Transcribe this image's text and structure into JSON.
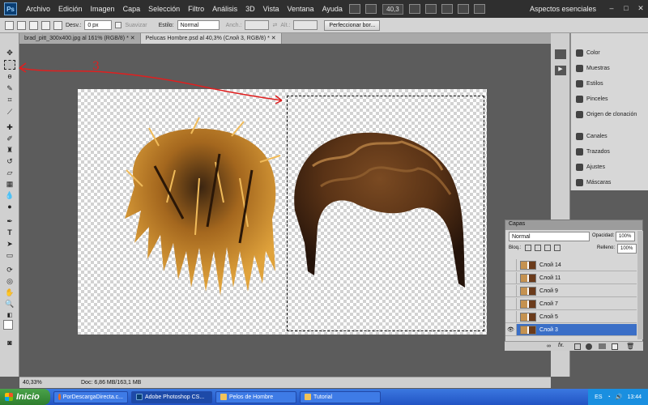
{
  "menubar": {
    "logo": "Ps",
    "items": [
      "Archivo",
      "Edición",
      "Imagen",
      "Capa",
      "Selección",
      "Filtro",
      "Análisis",
      "3D",
      "Vista",
      "Ventana",
      "Ayuda"
    ],
    "zoom": "40,3",
    "workspace": "Aspectos esenciales",
    "window_buttons": [
      "–",
      "□",
      "✕"
    ]
  },
  "options": {
    "feather_label": "Desv.:",
    "feather_value": "0 px",
    "antialias_label": "Suavizar",
    "style_label": "Estilo:",
    "style_value": "Normal",
    "width_label": "Anch.:",
    "height_label": "Alt.:",
    "refine_button": "Perfeccionar bor..."
  },
  "tabs": [
    {
      "label": "brad_pitt_300x400.jpg al 161% (RGB/8) *  ✕"
    },
    {
      "label": "Pelucas Hombre.psd al 40,3% (Слой 3, RGB/8) *  ✕"
    }
  ],
  "annotation": {
    "number": "3",
    "color": "#e01f1f"
  },
  "status": {
    "zoom": "40,33%",
    "doc": "Doc: 6,86 MB/163,1 MB"
  },
  "panels": [
    {
      "label": "Color",
      "icon": "color-icon"
    },
    {
      "label": "Muestras",
      "icon": "swatches-icon"
    },
    {
      "label": "Estilos",
      "icon": "styles-icon"
    },
    {
      "label": "Pinceles",
      "icon": "brushes-icon"
    },
    {
      "label": "Origen de clonación",
      "icon": "clone-source-icon"
    },
    {
      "label": "Canales",
      "icon": "channels-icon"
    },
    {
      "label": "Trazados",
      "icon": "paths-icon"
    },
    {
      "label": "Ajustes",
      "icon": "adjustments-icon"
    },
    {
      "label": "Máscaras",
      "icon": "masks-icon"
    }
  ],
  "layers_panel": {
    "title": "Capas",
    "blend_mode": "Normal",
    "opacity_label": "Opacidad:",
    "opacity_value": "100%",
    "lock_label": "Bloq.:",
    "fill_label": "Relleno:",
    "fill_value": "100%",
    "layers": [
      {
        "name": "Слой 14",
        "visible": false,
        "active": false
      },
      {
        "name": "Слой 11",
        "visible": false,
        "active": false
      },
      {
        "name": "Слой 9",
        "visible": false,
        "active": false
      },
      {
        "name": "Слой 7",
        "visible": false,
        "active": false
      },
      {
        "name": "Слой 5",
        "visible": false,
        "active": false
      },
      {
        "name": "Слой 3",
        "visible": true,
        "active": true
      }
    ],
    "footer_icons": [
      "link-icon",
      "fx-icon",
      "mask-icon",
      "adjustment-icon",
      "folder-icon",
      "new-layer-icon",
      "trash-icon"
    ]
  },
  "taskbar": {
    "start": "Inicio",
    "tasks": [
      {
        "label": "PorDescargaDirecta.c..."
      },
      {
        "label": "Adobe Photoshop CS..."
      },
      {
        "label": "Pelos de Hombre"
      },
      {
        "label": "Tutorial"
      }
    ],
    "lang": "ES",
    "time": "13:44"
  }
}
